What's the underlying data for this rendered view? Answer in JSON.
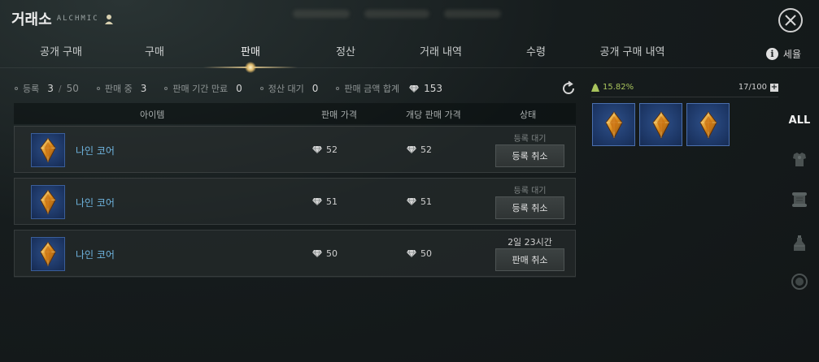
{
  "header": {
    "title": "거래소",
    "server": "ALCHMIC"
  },
  "tabs": [
    {
      "label": "공개 구매",
      "active": false
    },
    {
      "label": "구매",
      "active": false
    },
    {
      "label": "판매",
      "active": true
    },
    {
      "label": "정산",
      "active": false
    },
    {
      "label": "거래 내역",
      "active": false
    },
    {
      "label": "수령",
      "active": false
    },
    {
      "label": "공개 구매 내역",
      "active": false
    }
  ],
  "fee": {
    "label": "세율"
  },
  "stats": {
    "registered_label": "등록",
    "registered_value": "3",
    "registered_sep": "/",
    "registered_max": "50",
    "selling_label": "판매 중",
    "selling_value": "3",
    "expired_label": "판매 기간 만료",
    "expired_value": "0",
    "pending_label": "정산 대기",
    "pending_value": "0",
    "total_label": "판매 금액 합계",
    "total_value": "153"
  },
  "table": {
    "headers": {
      "item": "아이템",
      "price": "판매 가격",
      "unit_price": "개당 판매 가격",
      "status": "상태"
    },
    "rows": [
      {
        "name": "나인 코어",
        "price": "52",
        "unit_price": "52",
        "status": "등록 대기",
        "button": "등록 취소"
      },
      {
        "name": "나인 코어",
        "price": "51",
        "unit_price": "51",
        "status": "등록 대기",
        "button": "등록 취소"
      },
      {
        "name": "나인 코어",
        "price": "50",
        "unit_price": "50",
        "status": "2일 23시간",
        "button": "판매 취소"
      }
    ]
  },
  "inventory": {
    "rate": "15.82%",
    "slots": "17/100",
    "items": [
      "nine-core",
      "nine-core",
      "nine-core"
    ]
  },
  "categories": {
    "all_label": "ALL",
    "icons": [
      "armor-icon",
      "scroll-icon",
      "potion-icon",
      "misc-gem-icon"
    ]
  },
  "colors": {
    "item_name": "#6fb4df",
    "rate": "#a9c45c",
    "accent_gold": "#d9c28a",
    "slot_bg": "#1d3766"
  }
}
